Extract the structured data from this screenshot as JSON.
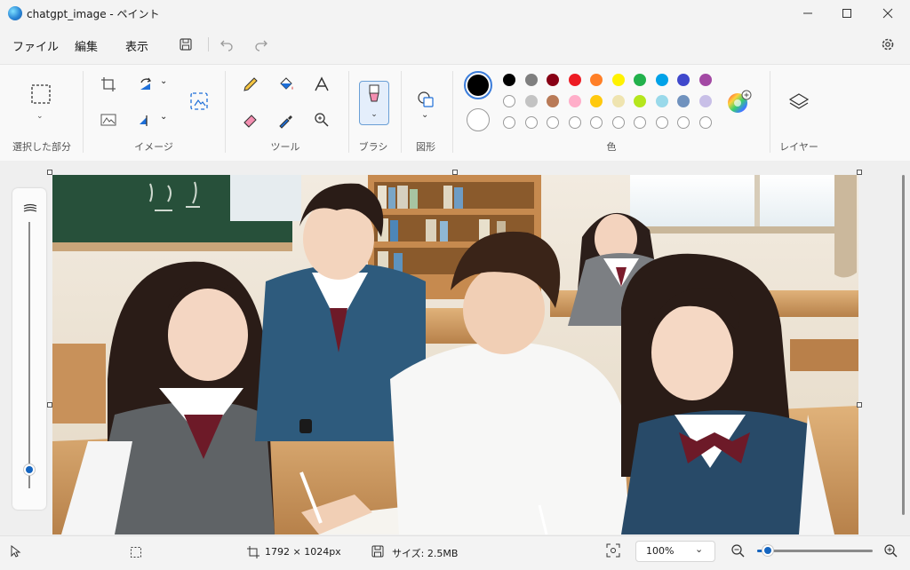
{
  "window": {
    "title": "chatgpt_image - ペイント"
  },
  "menubar": {
    "file": "ファイル",
    "edit": "編集",
    "view": "表示"
  },
  "ribbon": {
    "groups": {
      "selection": "選択した部分",
      "image": "イメージ",
      "tools": "ツール",
      "brush": "ブラシ",
      "shapes": "図形",
      "colors": "色",
      "layers": "レイヤー"
    },
    "colors": {
      "primary": "#000000",
      "secondary": "#ffffff",
      "palette_row1": [
        "#000000",
        "#7f7f7f",
        "#880015",
        "#ed1c24",
        "#ff7f27",
        "#fff200",
        "#22b14c",
        "#00a2e8",
        "#3f48cc",
        "#a349a4"
      ],
      "palette_row2": [
        "#ffffff",
        "#c3c3c3",
        "#b97a57",
        "#ffaec9",
        "#ffc90e",
        "#efe4b0",
        "#b5e61d",
        "#99d9ea",
        "#7092be",
        "#c8bfe7"
      ],
      "palette_row3_empty_count": 10
    }
  },
  "statusbar": {
    "dimensions": "1792 × 1024px",
    "size": "サイズ: 2.5MB",
    "zoom": "100%"
  },
  "zoom_level_fraction": 0.07
}
